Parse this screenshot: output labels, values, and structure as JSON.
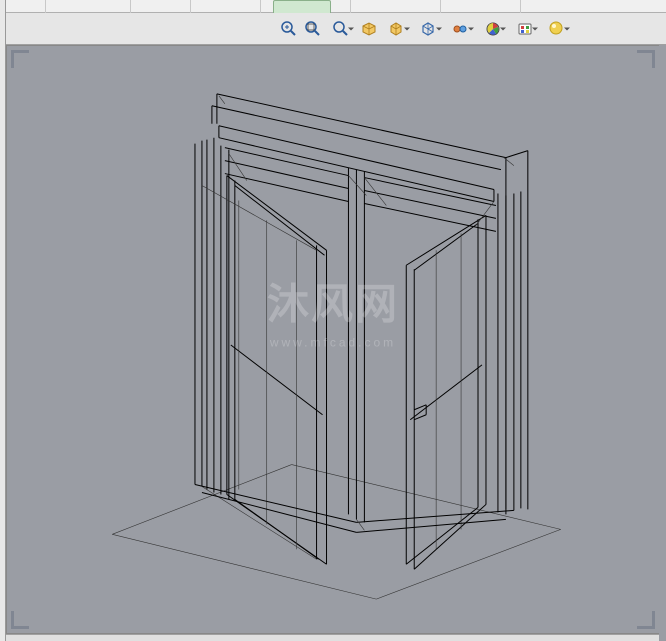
{
  "toolbar": {
    "zoom_fit": "zoom-to-fit",
    "zoom_area": "zoom-to-area",
    "prev_view": "previous-view",
    "section": "section-view",
    "display_style": "display-style",
    "hide_show": "hide-show-items",
    "edit_appearance": "edit-appearance",
    "apply_scene": "apply-scene",
    "view_settings": "view-settings"
  },
  "watermark": {
    "main": "沐风网",
    "sub": "www.mfcad.com"
  }
}
